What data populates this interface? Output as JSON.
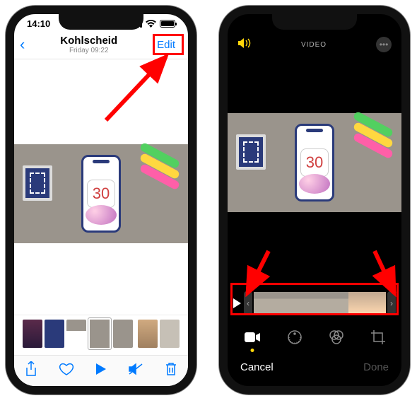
{
  "left_phone": {
    "statusbar": {
      "time": "14:10"
    },
    "navbar": {
      "location": "Kohlscheid",
      "date": "Friday  09:22",
      "edit_label": "Edit"
    },
    "preview": {
      "number_overlay": "30"
    }
  },
  "right_phone": {
    "editbar": {
      "center_label": "VIDEO"
    },
    "bottombar": {
      "cancel_label": "Cancel",
      "done_label": "Done"
    }
  },
  "annotations": {
    "highlight_color": "#ff0000"
  }
}
